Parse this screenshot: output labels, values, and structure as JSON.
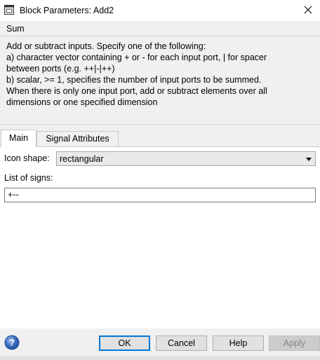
{
  "window": {
    "title": "Block Parameters: Add2",
    "close_icon": "close-icon"
  },
  "description": {
    "group_title": "Sum",
    "lines": [
      "Add or subtract inputs.  Specify one of the following:",
      "a) character vector containing + or - for each input port, | for spacer",
      "between ports (e.g. ++|-|++)",
      "b) scalar, >= 1, specifies the number of input ports to be summed.",
      "When there is only one input port, add or subtract elements over all",
      "dimensions or one specified dimension"
    ]
  },
  "tabs": {
    "main": "Main",
    "signal_attributes": "Signal Attributes",
    "active": "Main"
  },
  "main": {
    "icon_shape_label": "Icon shape:",
    "icon_shape_value": "rectangular",
    "list_of_signs_label": "List of signs:",
    "list_of_signs_value": "+--"
  },
  "buttons": {
    "ok": "OK",
    "cancel": "Cancel",
    "help": "Help",
    "apply": "Apply"
  },
  "colors": {
    "ok_border": "#0078d7",
    "help_icon": "#3b6dbf"
  }
}
